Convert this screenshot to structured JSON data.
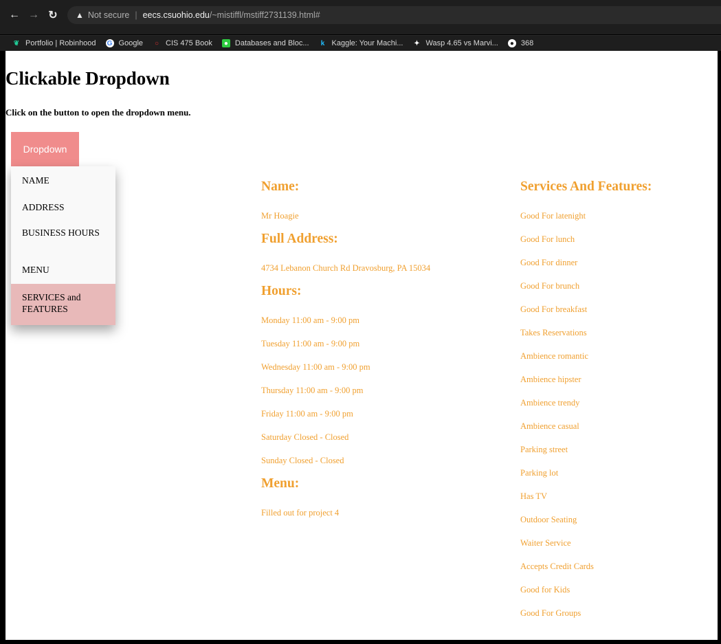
{
  "browser": {
    "url_warning": "Not secure",
    "url_host": "eecs.csuohio.edu",
    "url_path": "/~mistiffl/mstiff2731139.html#",
    "bookmarks": [
      {
        "label": "Portfolio | Robinhood",
        "icon": "robinhood-icon",
        "color": "#21ce99"
      },
      {
        "label": "Google",
        "icon": "google-icon",
        "color": "#4285f4"
      },
      {
        "label": "CIS 475 Book",
        "icon": "book-icon",
        "color": "#e03030"
      },
      {
        "label": "Databases and Bloc...",
        "icon": "database-icon",
        "color": "#2ecc40"
      },
      {
        "label": "Kaggle: Your Machi...",
        "icon": "kaggle-icon",
        "color": "#20beff"
      },
      {
        "label": "Wasp 4.65 vs Marvi...",
        "icon": "wasp-icon",
        "color": "#ffffff"
      },
      {
        "label": "368",
        "icon": "globe-icon",
        "color": "#ffffff"
      }
    ]
  },
  "page": {
    "title": "Clickable Dropdown",
    "subtitle": "Click on the button to open the dropdown menu.",
    "dropdown_label": "Dropdown",
    "menu": [
      "NAME",
      "ADDRESS",
      "BUSINESS HOURS",
      "MENU",
      "SERVICES and FEATURES"
    ],
    "accent_color": "#f0a030",
    "button_color": "#f08c8c"
  },
  "info": {
    "name_header": "Name:",
    "name": "Mr Hoagie",
    "address_header": "Full Address:",
    "address": "4734 Lebanon Church Rd Dravosburg, PA 15034",
    "hours_header": "Hours:",
    "hours": [
      "Monday 11:00 am - 9:00 pm",
      "Tuesday 11:00 am - 9:00 pm",
      "Wednesday 11:00 am - 9:00 pm",
      "Thursday 11:00 am - 9:00 pm",
      "Friday 11:00 am - 9:00 pm",
      "Saturday Closed - Closed",
      "Sunday Closed - Closed"
    ],
    "menu_header": "Menu:",
    "menu_text": "Filled out for project 4",
    "services_header": "Services And Features:",
    "services": [
      "Good For latenight",
      "Good For lunch",
      "Good For dinner",
      "Good For brunch",
      "Good For breakfast",
      "Takes Reservations",
      "Ambience romantic",
      "Ambience hipster",
      "Ambience trendy",
      "Ambience casual",
      "Parking street",
      "Parking lot",
      "Has TV",
      "Outdoor Seating",
      "Waiter Service",
      "Accepts Credit Cards",
      "Good for Kids",
      "Good For Groups"
    ]
  }
}
